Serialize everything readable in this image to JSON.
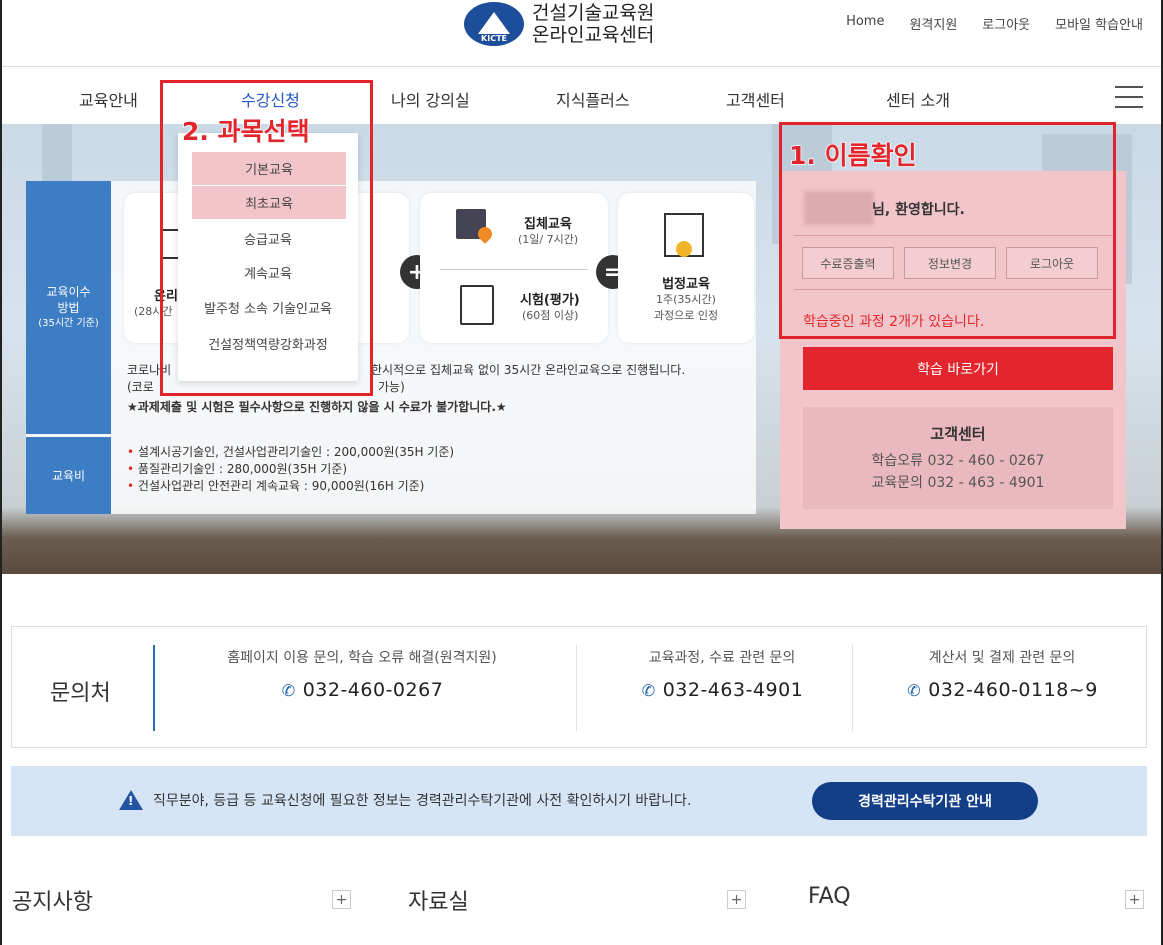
{
  "header": {
    "logo_line1": "건설기술교육원",
    "logo_line2": "온라인교육센터",
    "logo_badge": "KICTE",
    "util_links": [
      "Home",
      "원격지원",
      "로그아웃",
      "모바일 학습안내"
    ]
  },
  "nav": {
    "items": [
      "교육안내",
      "수강신청",
      "나의 강의실",
      "지식플러스",
      "고객센터",
      "센터 소개"
    ]
  },
  "dropdown": {
    "items": [
      "기본교육",
      "최초교육",
      "승급교육",
      "계속교육",
      "발주청 소속 기술인교육",
      "건설정책역량강화과정"
    ]
  },
  "annotations": {
    "step1": "1. 이름확인",
    "step2": "2. 과목선택"
  },
  "edu": {
    "method_label": [
      "교육이수",
      "방법",
      "(35시간 기준)"
    ],
    "online_partial": "온리",
    "online_sub_partial": "(28시간",
    "group_title": "집체교육",
    "group_sub": "(1일/ 7시간)",
    "exam_title": "시험(평가)",
    "exam_sub": "(60점 이상)",
    "legal_title": "법정교육",
    "legal_sub1": "1주(35시간)",
    "legal_sub2": "과정으로 인정",
    "plus": "+",
    "equals": "=",
    "notice1_a": "코로나비",
    "notice1_b": "한시적으로 집체교육 없이 35시간 온라인교육으로 진행됩니다.",
    "notice1_c": "(코로",
    "notice1_d": "가능)",
    "notice2": "★과제제출 및 시험은 필수사항으로 진행하지 않을 시 수료가 불가합니다.★",
    "fee_label": "교육비",
    "fees": [
      "설계시공기술인, 건설사업관리기술인 : 200,000원(35H 기준)",
      "품질관리기술인 : 280,000원(35H 기준)",
      "건설사업관리 안전관리 계속교육 : 90,000원(16H 기준)"
    ]
  },
  "user": {
    "welcome": "님, 환영합니다.",
    "buttons": [
      "수료증출력",
      "정보변경",
      "로그아웃"
    ],
    "status": "학습중인 과정 2개가 있습니다.",
    "go_button": "학습 바로가기",
    "cs_title": "고객센터",
    "cs_line1": "학습오류  032 - 460 - 0267",
    "cs_line2": "교육문의  032 - 463 - 4901"
  },
  "contact": {
    "title": "문의처",
    "cols": [
      {
        "q": "홈페이지 이용 문의, 학습 오류 해결(원격지원)",
        "p": "032-460-0267"
      },
      {
        "q": "교육과정, 수료 관련 문의",
        "p": "032-463-4901"
      },
      {
        "q": "계산서 및 결제 관련 문의",
        "p": "032-460-0118~9"
      }
    ]
  },
  "notice": {
    "text": "직무분야, 등급 등 교육신청에 필요한 정보는 경력관리수탁기관에 사전 확인하시기 바랍니다.",
    "button": "경력관리수탁기관 안내"
  },
  "boards": [
    "공지사항",
    "자료실",
    "FAQ"
  ],
  "colors": {
    "accent_red": "#e2242b",
    "brand_blue": "#1d4e9a",
    "side_blue": "#3d7dc4"
  }
}
